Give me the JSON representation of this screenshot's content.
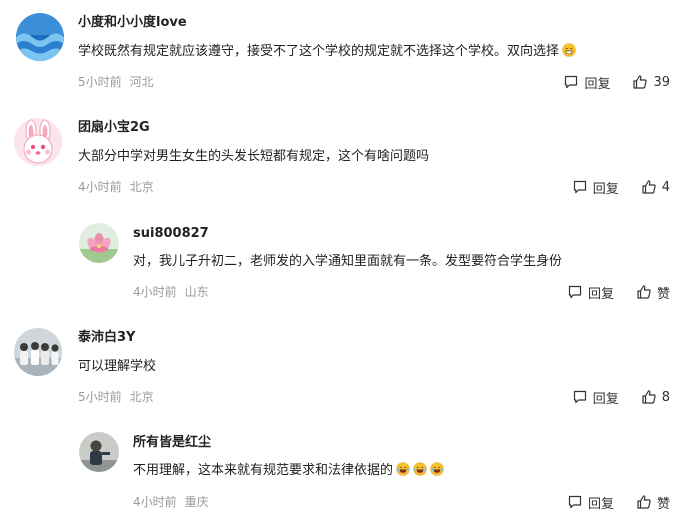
{
  "ui": {
    "reply_label": "回复",
    "like_placeholder": "赞"
  },
  "comments": [
    {
      "username": "小度和小小度love",
      "content": "学校既然有规定就应该遵守，接受不了这个学校的规定就不选择这个学校。双向选择",
      "time": "5小时前",
      "location": "河北",
      "likes": "39",
      "avatar_icon": "blue-wave-avatar",
      "emoji": "grin-emoji"
    },
    {
      "username": "团扇小宝2G",
      "content": "大部分中学对男生女生的头发长短都有规定，这个有啥问题吗",
      "time": "4小时前",
      "location": "北京",
      "likes": "4",
      "avatar_icon": "pink-bunny-avatar"
    },
    {
      "username": "sui800827",
      "content": "对，我儿子升初二，老师发的入学通知里面就有一条。发型要符合学生身份",
      "time": "4小时前",
      "location": "山东",
      "likes": "赞",
      "avatar_icon": "lotus-flower-avatar"
    },
    {
      "username": "泰沛白3Y",
      "content": "可以理解学校",
      "time": "5小时前",
      "location": "北京",
      "likes": "8",
      "avatar_icon": "group-photo-avatar"
    },
    {
      "username": "所有皆是红尘",
      "content": "不用理解，这本来就有规范要求和法律依据的",
      "time": "4小时前",
      "location": "重庆",
      "likes": "赞",
      "avatar_icon": "person-photo-avatar",
      "emoji": "laughing-emoji"
    }
  ],
  "colors": {
    "text": "#222222",
    "meta": "#9a9a9a",
    "emoji_yellow": "#f7c12d"
  }
}
